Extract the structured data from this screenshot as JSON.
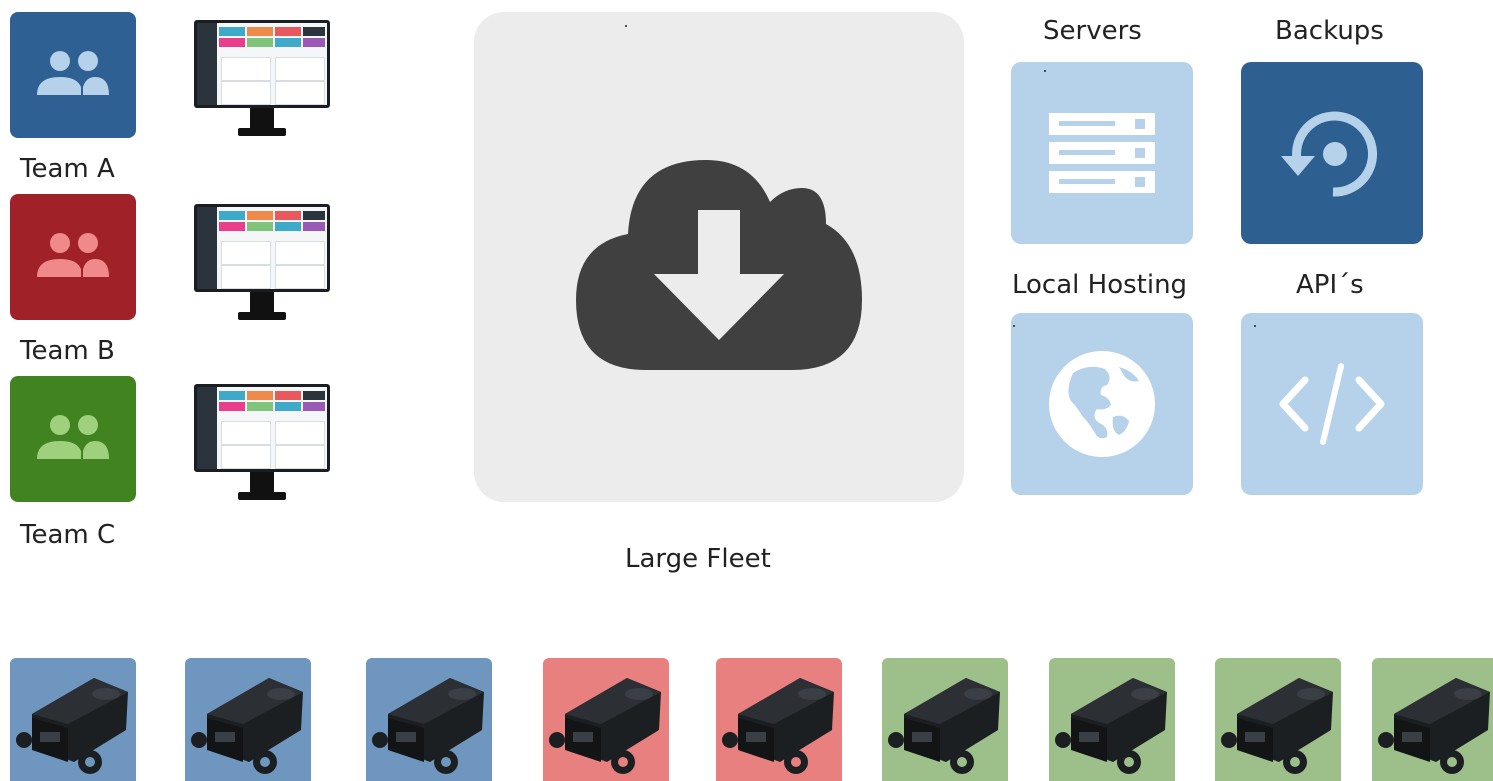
{
  "teams": [
    {
      "label": "Team A",
      "color": "#2e6094",
      "icon_color": "#b6d1ea"
    },
    {
      "label": "Team B",
      "color": "#a12128",
      "icon_color": "#f08a8a"
    },
    {
      "label": "Team C",
      "color": "#408320",
      "icon_color": "#9fd07e"
    }
  ],
  "center": {
    "label": "Large Fleet",
    "icon": "cloud-download-icon"
  },
  "services": [
    {
      "label": "Servers",
      "icon": "server-icon"
    },
    {
      "label": "Backups",
      "icon": "restore-icon"
    },
    {
      "label": "Local Hosting",
      "icon": "globe-icon"
    },
    {
      "label": "API´s",
      "icon": "code-icon"
    }
  ],
  "devices": [
    {
      "team": "Team A",
      "color": "#6f96bf"
    },
    {
      "team": "Team A",
      "color": "#6f96bf"
    },
    {
      "team": "Team A",
      "color": "#6f96bf"
    },
    {
      "team": "Team B",
      "color": "#e88080"
    },
    {
      "team": "Team B",
      "color": "#e88080"
    },
    {
      "team": "Team C",
      "color": "#9dbf8a"
    },
    {
      "team": "Team C",
      "color": "#9dbf8a"
    },
    {
      "team": "Team C",
      "color": "#9dbf8a"
    },
    {
      "team": "Team C",
      "color": "#9dbf8a"
    }
  ]
}
